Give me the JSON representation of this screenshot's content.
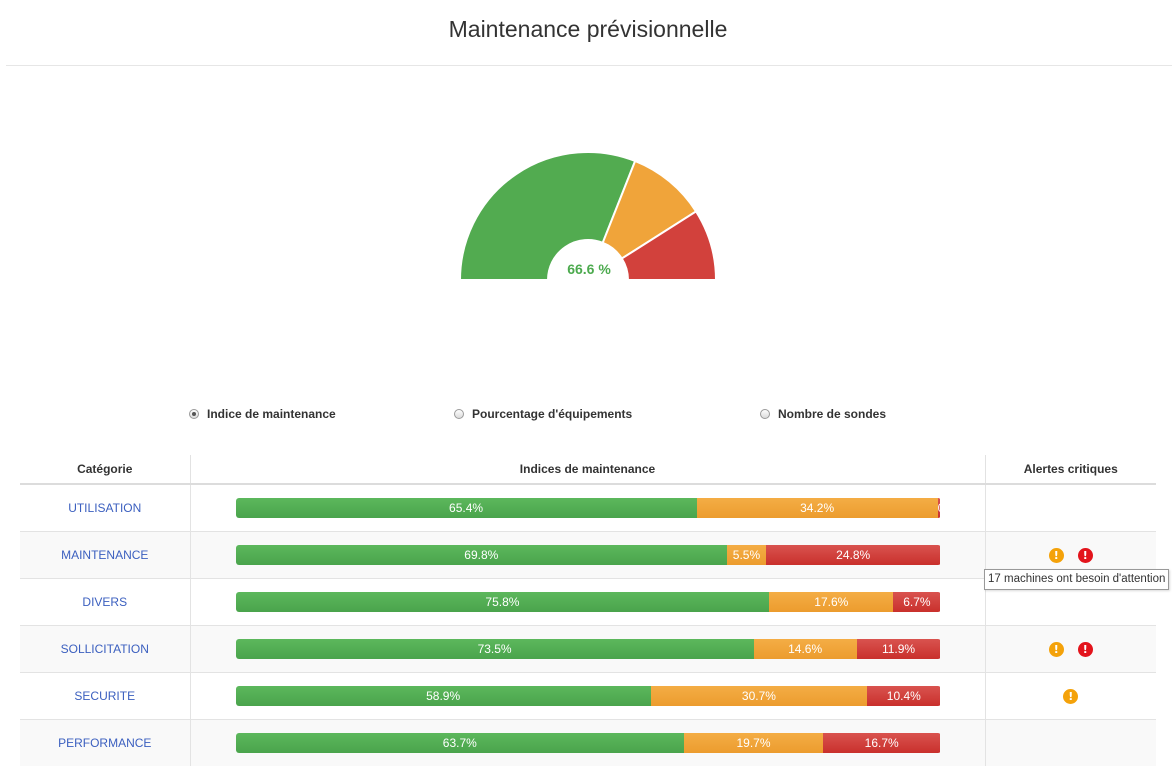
{
  "title": "Maintenance prévisionnelle",
  "gauge": {
    "value_text": "66.6 %",
    "segments": [
      {
        "name": "green",
        "fraction": 0.62,
        "color": "#52ab50"
      },
      {
        "name": "orange",
        "fraction": 0.2,
        "color": "#f0a43a"
      },
      {
        "name": "red",
        "fraction": 0.18,
        "color": "#d2413c"
      }
    ]
  },
  "radio_options": [
    {
      "label": "Indice de maintenance",
      "checked": true
    },
    {
      "label": "Pourcentage d'équipements",
      "checked": false
    },
    {
      "label": "Nombre de sondes",
      "checked": false
    }
  ],
  "table": {
    "headers": [
      "Catégorie",
      "Indices de maintenance",
      "Alertes critiques"
    ],
    "rows": [
      {
        "category": "UTILISATION",
        "green": 65.4,
        "orange": 34.2,
        "red": 0.4,
        "green_label": "65.4%",
        "orange_label": "34.2%",
        "red_label": "0.4%",
        "alerts": []
      },
      {
        "category": "MAINTENANCE",
        "green": 69.8,
        "orange": 5.5,
        "red": 24.8,
        "green_label": "69.8%",
        "orange_label": "5.5%",
        "red_label": "24.8%",
        "alerts": [
          "warning-icon",
          "critical-icon"
        ]
      },
      {
        "category": "DIVERS",
        "green": 75.8,
        "orange": 17.6,
        "red": 6.7,
        "green_label": "75.8%",
        "orange_label": "17.6%",
        "red_label": "6.7%",
        "alerts": []
      },
      {
        "category": "SOLLICITATION",
        "green": 73.5,
        "orange": 14.6,
        "red": 11.9,
        "green_label": "73.5%",
        "orange_label": "14.6%",
        "red_label": "11.9%",
        "alerts": [
          "warning-icon",
          "critical-icon"
        ]
      },
      {
        "category": "SECURITE",
        "green": 58.9,
        "orange": 30.7,
        "red": 10.4,
        "green_label": "58.9%",
        "orange_label": "30.7%",
        "red_label": "10.4%",
        "alerts": [
          "warning-icon"
        ]
      },
      {
        "category": "PERFORMANCE",
        "green": 63.7,
        "orange": 19.7,
        "red": 16.7,
        "green_label": "63.7%",
        "orange_label": "19.7%",
        "red_label": "16.7%",
        "alerts": []
      }
    ]
  },
  "tooltip": {
    "text": "17 machines ont besoin d'attention"
  }
}
